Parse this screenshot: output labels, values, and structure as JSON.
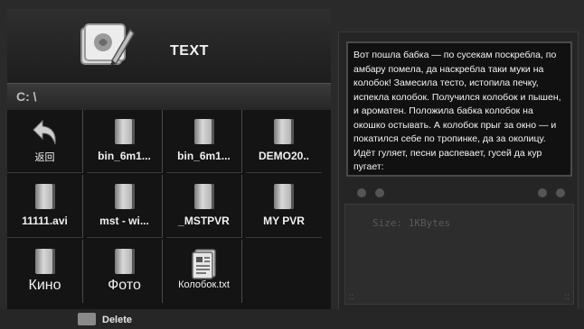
{
  "header": {
    "title": "TEXT",
    "icon": "text-editor-icon"
  },
  "path": {
    "label": "C: \\"
  },
  "files": [
    {
      "name": "返回",
      "icon": "back-arrow-icon"
    },
    {
      "name": "bin_6m1...",
      "icon": "book-icon"
    },
    {
      "name": "bin_6m1...",
      "icon": "book-icon"
    },
    {
      "name": "DEMO20..",
      "icon": "book-icon"
    },
    {
      "name": "11111.avi",
      "icon": "book-icon"
    },
    {
      "name": "mst - wi...",
      "icon": "book-icon"
    },
    {
      "name": "_MSTPVR",
      "icon": "book-icon"
    },
    {
      "name": "MY PVR",
      "icon": "book-icon"
    },
    {
      "name": "Кино",
      "icon": "book-icon"
    },
    {
      "name": "Фото",
      "icon": "book-icon"
    },
    {
      "name": "Колобок.txt",
      "icon": "text-file-icon"
    }
  ],
  "preview": {
    "text": "Вот пошла бабка — по сусекам поскребла, по амбару помела, да наскребла таки муки на колобок! Замесила тесто, истопила печку, испекла колобок. Получился колобок и пышен, и ароматен. Положила бабка колобок на окошко остывать. А колобок прыг за окно — и покатился себе по тропинке, да за околицу. Идёт гуляет, песни распевает, гусей да кур пугает:"
  },
  "info": {
    "size": "Size:  1KBytes"
  },
  "footer": {
    "delete_label": "Delete"
  }
}
